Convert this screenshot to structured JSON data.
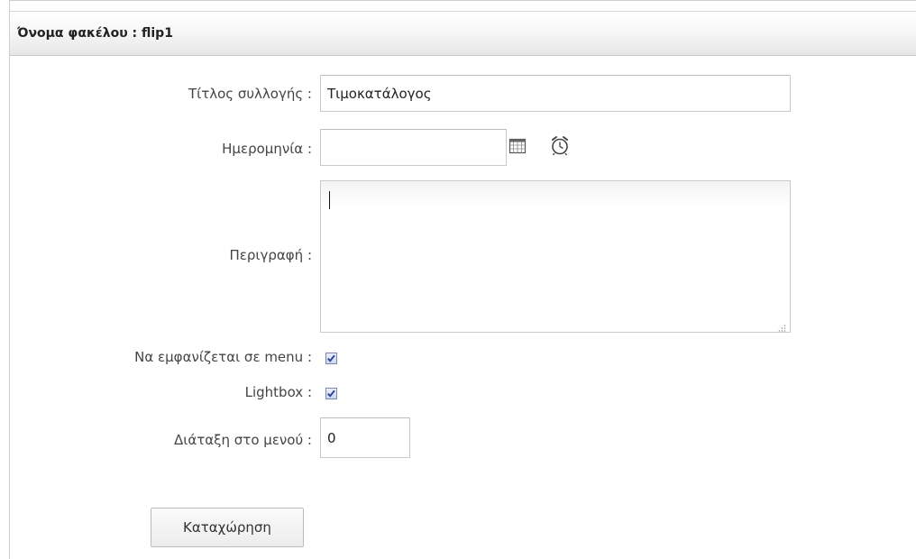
{
  "header": {
    "title": "Όνομα φακέλου : flip1"
  },
  "form": {
    "title_label": "Τίτλος συλλογής :",
    "title_value": "Τιμοκατάλογος",
    "date_label": "Ημερομηνία :",
    "date_value": "",
    "description_label": "Περιγραφή :",
    "description_value": "",
    "show_in_menu_label": "Να εμφανίζεται σε menu :",
    "show_in_menu_checked": true,
    "lightbox_label": "Lightbox :",
    "lightbox_checked": true,
    "menu_order_label": "Διάταξη στο μενού :",
    "menu_order_value": "0",
    "submit_label": "Καταχώρηση"
  },
  "icons": {
    "calendar": "calendar-icon",
    "clock": "alarm-clock-icon",
    "resize": "resize-grip-icon"
  },
  "colors": {
    "checkbox_mark": "#2a3f86",
    "border": "#c9c9c9"
  }
}
